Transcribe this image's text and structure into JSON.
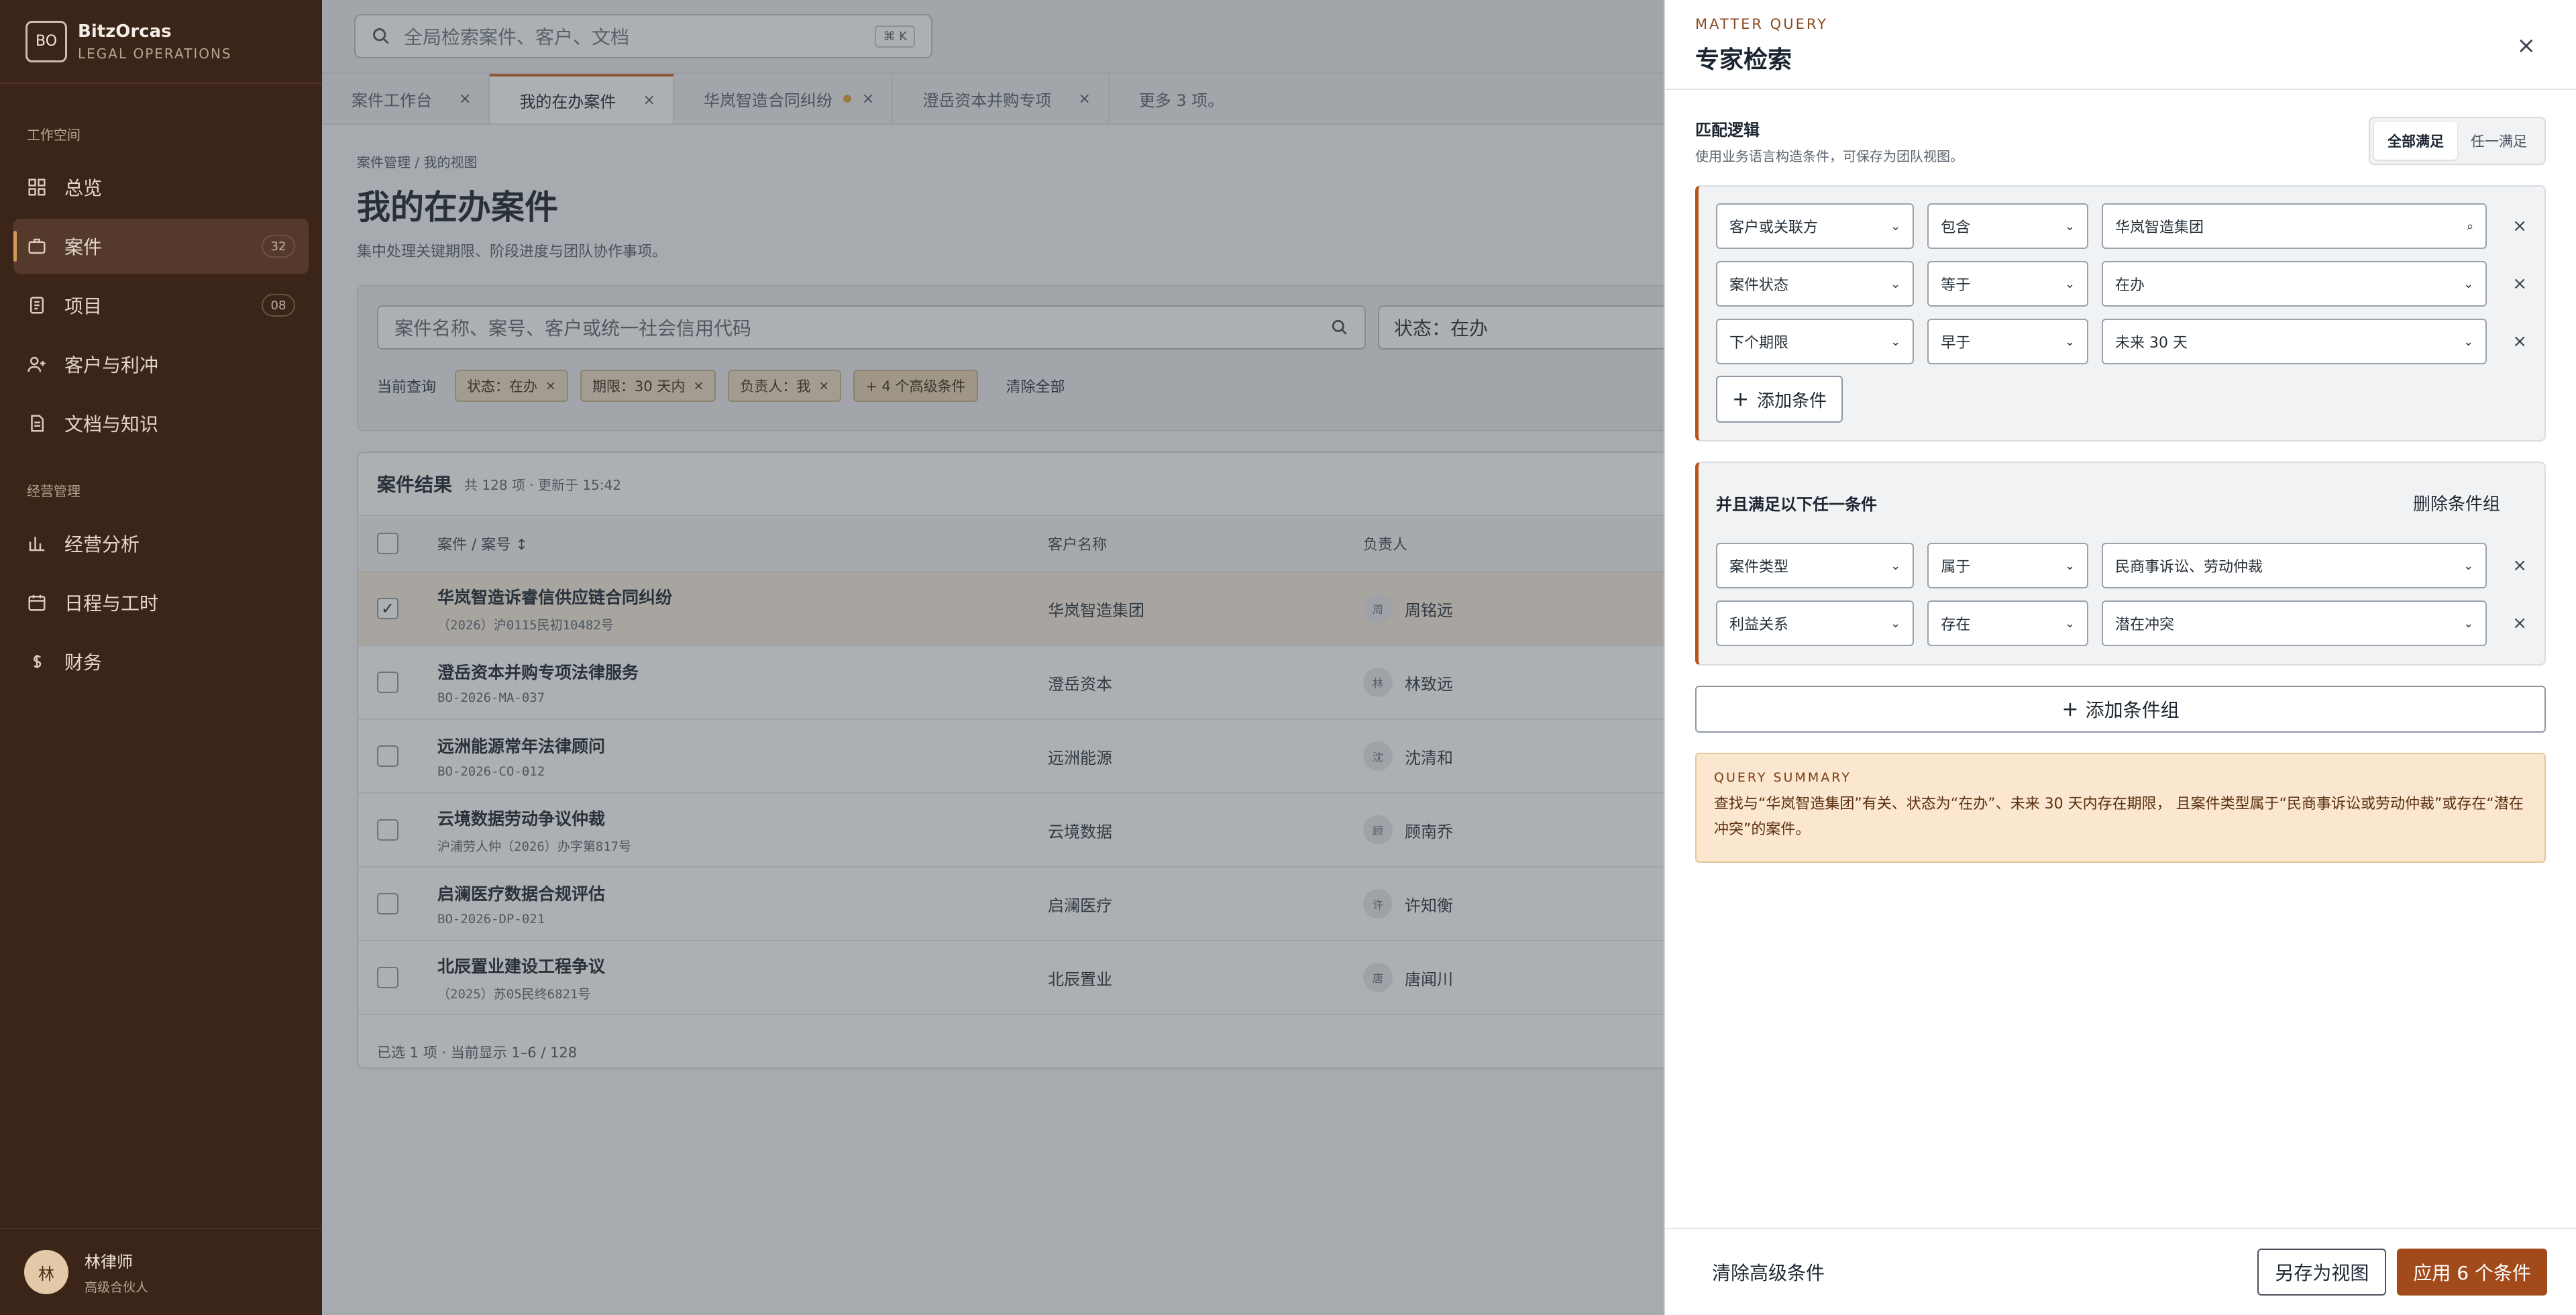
{
  "app": {
    "logo_text": "BO",
    "name": "BitzOrcas",
    "subtitle": "LEGAL OPERATIONS"
  },
  "sidebar": {
    "section_workspace": "工作空间",
    "section_management": "经营管理",
    "items": [
      {
        "label": "总览",
        "icon": "grid-icon"
      },
      {
        "label": "案件",
        "icon": "briefcase-icon",
        "badge": "32"
      },
      {
        "label": "项目",
        "icon": "clipboard-icon",
        "badge": "08"
      },
      {
        "label": "客户与利冲",
        "icon": "user-plus-icon"
      },
      {
        "label": "文档与知识",
        "icon": "document-icon"
      }
    ],
    "mgmt_items": [
      {
        "label": "经营分析",
        "icon": "bar-chart-icon"
      },
      {
        "label": "日程与工时",
        "icon": "calendar-icon"
      },
      {
        "label": "财务",
        "icon": "currency-icon"
      }
    ],
    "user": {
      "avatar": "林",
      "name": "林律师",
      "role": "高级合伙人"
    }
  },
  "topbar": {
    "search_placeholder": "全局检索案件、客户、文档",
    "shortcut": "⌘ K"
  },
  "tabs": [
    {
      "label": "案件工作台"
    },
    {
      "label": "我的在办案件"
    },
    {
      "label": "华岚智造合同纠纷"
    },
    {
      "label": "澄岳资本并购专项"
    },
    {
      "label": "更多 3 项。"
    }
  ],
  "page": {
    "breadcrumb": "案件管理 / 我的视图",
    "title": "我的在办案件",
    "subtitle": "集中处理关键期限、阶段进度与团队协作事项。"
  },
  "filters": {
    "search_placeholder": "案件名称、案号、客户或统一社会信用代码",
    "status_select": "状态：在办",
    "current_label": "当前查询",
    "chips": [
      "状态：在办",
      "期限：30 天内",
      "负责人：我"
    ],
    "advanced_chip": "+ 4 个高级条件",
    "clear_all": "清除全部"
  },
  "results": {
    "title": "案件结果",
    "meta": "共 128 项 · 更新于 15:42",
    "columns": {
      "case": "案件 / 案号 ↕",
      "client": "客户名称",
      "owner": "负责人"
    },
    "rows": [
      {
        "name": "华岚智造诉睿信供应链合同纠纷",
        "no": "（2026）沪0115民初10482号",
        "client": "华岚智造集团",
        "owner_initial": "周",
        "owner": "周铭远",
        "checked": true
      },
      {
        "name": "澄岳资本并购专项法律服务",
        "no": "BO-2026-MA-037",
        "client": "澄岳资本",
        "owner_initial": "林",
        "owner": "林致远",
        "checked": false
      },
      {
        "name": "远洲能源常年法律顾问",
        "no": "BO-2026-CO-012",
        "client": "远洲能源",
        "owner_initial": "沈",
        "owner": "沈清和",
        "checked": false
      },
      {
        "name": "云境数据劳动争议仲裁",
        "no": "沪浦劳人仲（2026）办字第817号",
        "client": "云境数据",
        "owner_initial": "顾",
        "owner": "顾南乔",
        "checked": false
      },
      {
        "name": "启澜医疗数据合规评估",
        "no": "BO-2026-DP-021",
        "client": "启澜医疗",
        "owner_initial": "许",
        "owner": "许知衡",
        "checked": false
      },
      {
        "name": "北辰置业建设工程争议",
        "no": "（2025）苏05民终6821号",
        "client": "北辰置业",
        "owner_initial": "唐",
        "owner": "唐闻川",
        "checked": false
      }
    ],
    "footer": "已选 1 项 · 当前显示 1–6 / 128"
  },
  "drawer": {
    "kicker": "MATTER QUERY",
    "title": "专家检索",
    "close": "×",
    "logic_title": "匹配逻辑",
    "logic_sub": "使用业务语言构造条件，可保存为团队视图。",
    "seg_all": "全部满足",
    "seg_any": "任一满足",
    "group1": [
      {
        "field": "客户或关联方",
        "op": "包含",
        "value": "华岚智造集团",
        "value_icon": "search-icon"
      },
      {
        "field": "案件状态",
        "op": "等于",
        "value": "在办"
      },
      {
        "field": "下个期限",
        "op": "早于",
        "value": "未来 30 天"
      }
    ],
    "add_condition": "添加条件",
    "group2_title": "并且满足以下任一条件",
    "delete_group": "删除条件组",
    "group2": [
      {
        "field": "案件类型",
        "op": "属于",
        "value": "民商事诉讼、劳动仲裁"
      },
      {
        "field": "利益关系",
        "op": "存在",
        "value": "潜在冲突"
      }
    ],
    "add_group": "添加条件组",
    "summary_kicker": "QUERY SUMMARY",
    "summary_text": "查找与“华岚智造集团”有关、状态为“在办”、未来 30 天内存在期限， 且案件类型属于“民商事诉讼或劳动仲裁”或存在“潜在冲突”的案件。",
    "clear_advanced": "清除高级条件",
    "save_view": "另存为视图",
    "apply": "应用 6 个条件"
  },
  "colors": {
    "sidebar_bg": "#3b2418",
    "accent": "#a34a1a",
    "highlight": "#c6651f"
  }
}
